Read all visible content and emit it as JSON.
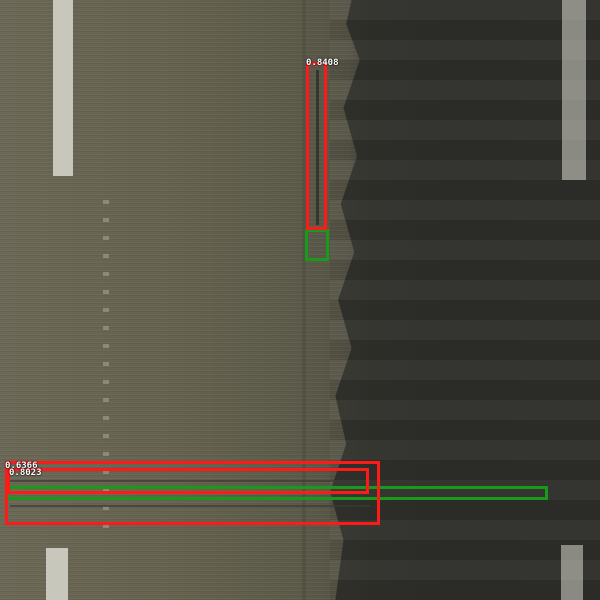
{
  "detections": [
    {
      "score": "0.8408",
      "kind": "prediction",
      "color": "#ff1a1a"
    },
    {
      "score": "0.6366",
      "kind": "prediction",
      "color": "#ff1a1a"
    },
    {
      "score": "0.8023",
      "kind": "prediction",
      "color": "#ff1a1a"
    }
  ],
  "ground_truth": [
    {
      "kind": "ground-truth",
      "color": "#1a9a1a"
    },
    {
      "kind": "ground-truth",
      "color": "#1a9a1a"
    }
  ]
}
